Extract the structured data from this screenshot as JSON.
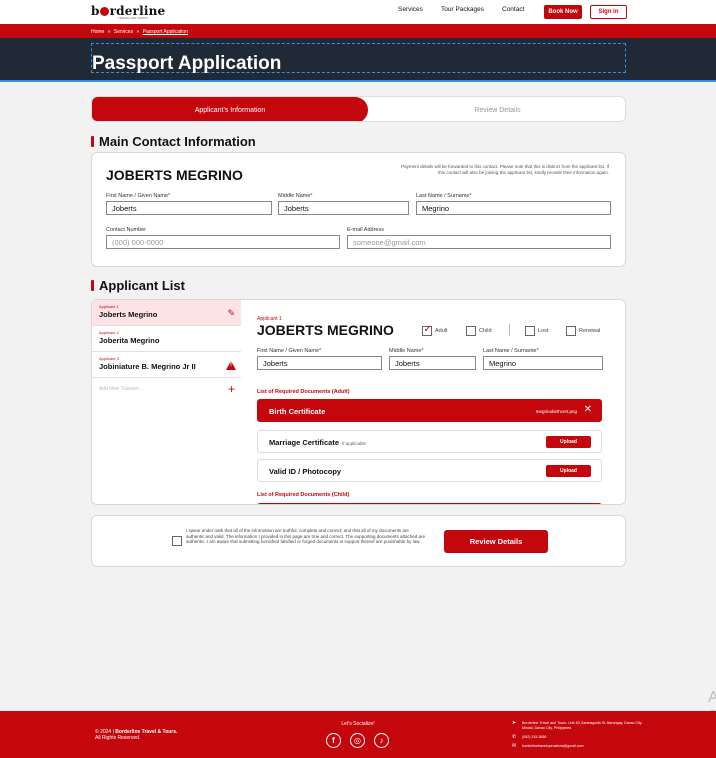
{
  "brand": {
    "name_left": "b",
    "name_right": "rderline",
    "tagline": "TRAVEL AND TOURS"
  },
  "nav": {
    "services": "Services",
    "tour_packages": "Tour Packages",
    "contact": "Contact",
    "book_now": "Book Now",
    "sign_in": "Sign in"
  },
  "breadcrumb": {
    "home": "Home",
    "sep": "»",
    "services": "Services",
    "current": "Passport Application"
  },
  "hero": {
    "tag": "",
    "title": "Passport Application"
  },
  "steps": {
    "active": "Applicant's Information",
    "next": "Review Details"
  },
  "main_contact": {
    "section_title": "Main Contact Information",
    "name": "JOBERTS MEGRINO",
    "note": "Payment details will be forwarded to this contact. Please note that this is distinct from the applicant list. If this contact will also be joining the applicant list, kindly provide their information again.",
    "first_label": "First Name / Given Name",
    "middle_label": "Middle Name",
    "last_label": "Last Name / Surname",
    "first_value": "Joberts",
    "middle_value": "Joberts",
    "last_value": "Megrino",
    "contact_label": "Contact Number",
    "contact_placeholder": "(000) 000-0000",
    "email_label": "E-mail Address",
    "email_placeholder": "someone@gmail.com",
    "required_mark": "*"
  },
  "applicant_list": {
    "section_title": "Applicant List",
    "items": [
      {
        "tag": "Applicant 1",
        "name": "Joberts Megrino"
      },
      {
        "tag": "Applicant 2",
        "name": "Joberita Megrino"
      },
      {
        "tag": "Applicant 3",
        "name": "Jobiniature B. Megrino Jr II"
      }
    ],
    "add_new": "Add New Traveler...",
    "edit_icon": "pencil-icon",
    "warning_icon": "warning-icon"
  },
  "applicant_detail": {
    "tag": "Applicant 1",
    "name": "JOBERTS MEGRINO",
    "types": [
      {
        "label": "Adult",
        "checked": true
      },
      {
        "label": "Child",
        "checked": false
      },
      {
        "label": "Lost",
        "checked": false
      },
      {
        "label": "Renewal",
        "checked": false
      }
    ],
    "first_label": "First Name / Given Name",
    "middle_label": "Middle Name",
    "last_label": "Last Name / Surname",
    "first_value": "Joberts",
    "middle_value": "Joberts",
    "last_value": "Megrino",
    "adult_docs_title": "List of Required Documents (Adult)",
    "child_docs_title": "List of Required Documents (Child)",
    "docs": [
      {
        "name": "Birth Certificate",
        "file": "megrinobirthcert.png",
        "uploaded": true
      },
      {
        "name": "Marriage Certificate",
        "note": "If applicable",
        "upload": "Upload"
      },
      {
        "name": "Valid ID / Photocopy",
        "upload": "Upload"
      }
    ]
  },
  "oath": {
    "text": "I swear under oath that all of the information are truthful, complete and correct; and that all of my documents are authentic and valid. The information I provided in this page are true and correct. The supporting documents attached are authentic. I am aware that submitting furnished falsified or forged documents in support thereof are punishable by law.",
    "button": "Review Details"
  },
  "footer": {
    "copyright_prefix": "© 2024 |",
    "company": "Borderline Travel & Tours.",
    "rights": "All Rights Reserved.",
    "social_title": "Let's Socialize!",
    "social_icons": [
      "facebook-icon",
      "instagram-icon",
      "tiktok-icon"
    ],
    "address": "Borderline Travel and Tours- Unit 4D Santosguilla St. Barangay, Davao City Mindal, Davao City, Philippines",
    "phone": "(082) 315 3858",
    "email": "borderlinetraveloperations@gmail.com"
  },
  "colors": {
    "accent": "#c4070d",
    "hero_bg": "#1f2a36",
    "hero_border": "#3b8fe0"
  }
}
